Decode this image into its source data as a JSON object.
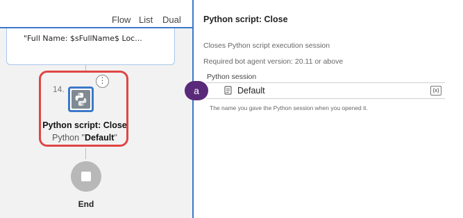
{
  "view_tabs": [
    "Flow",
    "List",
    "Dual"
  ],
  "previous_node": {
    "text": "\"Full Name: $sFullName$ Loc..."
  },
  "selected_node": {
    "index": "14.",
    "title": "Python script: Close",
    "subtitle_prefix": "Python \"",
    "subtitle_value": "Default",
    "subtitle_suffix": "\"",
    "icon": "python-icon",
    "border_color": "#e04545"
  },
  "end_node": {
    "label": "End",
    "icon": "stop-icon"
  },
  "properties": {
    "title": "Python script: Close",
    "description": "Closes Python script execution session",
    "version": "Required bot agent version: 20.11 or above",
    "session_label": "Python session",
    "session_value": "Default",
    "variable_button": "(x)",
    "session_hint": "The name you gave the Python session when you opened it."
  },
  "annotation": {
    "label": "a",
    "color": "#5a2a7a"
  },
  "colors": {
    "accent": "#3b78c9",
    "highlight": "#e04545"
  }
}
